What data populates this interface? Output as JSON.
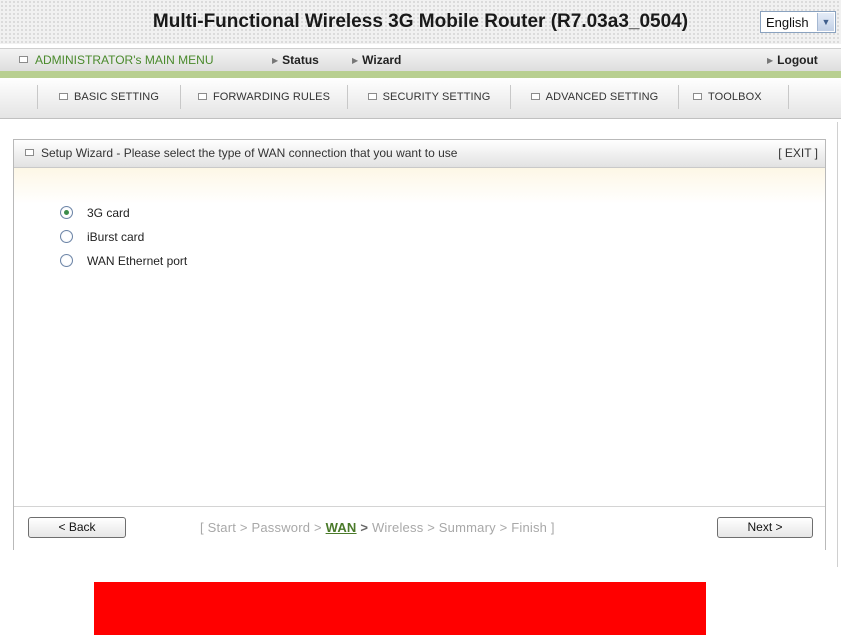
{
  "header": {
    "title": "Multi-Functional Wireless 3G Mobile Router (R7.03a3_0504)",
    "language": {
      "selected": "English"
    }
  },
  "menu": {
    "admin_label": "ADMINISTRATOR's MAIN MENU",
    "status_label": "Status",
    "wizard_label": "Wizard",
    "logout_label": "Logout"
  },
  "nav": {
    "tabs": [
      {
        "label": "BASIC SETTING"
      },
      {
        "label": "FORWARDING RULES"
      },
      {
        "label": "SECURITY SETTING"
      },
      {
        "label": "ADVANCED SETTING"
      },
      {
        "label": "TOOLBOX"
      }
    ]
  },
  "wizard": {
    "title": "Setup Wizard - Please select the type of WAN connection that you want to use",
    "exit_label": "[ EXIT ]",
    "options": [
      {
        "label": "3G card",
        "selected": true
      },
      {
        "label": "iBurst card",
        "selected": false
      },
      {
        "label": "WAN Ethernet port",
        "selected": false
      }
    ],
    "back_label": "< Back",
    "next_label": "Next >",
    "steps": {
      "before": "[ Start > Password > ",
      "current": "WAN",
      "current_sep": " > ",
      "after": "Wireless > Summary > Finish ]"
    }
  },
  "colors": {
    "accent_green": "#4a8a2c",
    "strip_green": "#b8cf90",
    "redacted_bar": "#ff0000"
  }
}
